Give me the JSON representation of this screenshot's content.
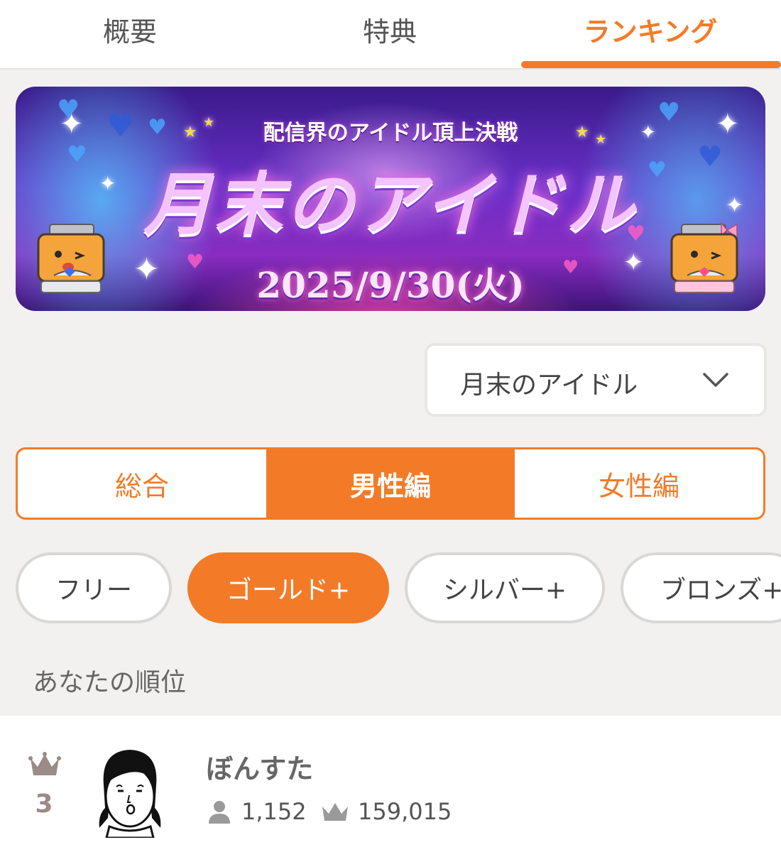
{
  "tabs": [
    {
      "label": "概要",
      "active": false
    },
    {
      "label": "特典",
      "active": false
    },
    {
      "label": "ランキング",
      "active": true
    }
  ],
  "banner": {
    "subtitle": "配信界のアイドル頂上決戦",
    "title": "月末のアイドル",
    "date": "2025/9/30(火)"
  },
  "dropdown": {
    "selected": "月末のアイドル",
    "icon": "chevron-down-icon"
  },
  "segments": [
    {
      "label": "総合",
      "active": false
    },
    {
      "label": "男性編",
      "active": true
    },
    {
      "label": "女性編",
      "active": false
    }
  ],
  "tiers": [
    {
      "label": "フリー",
      "active": false
    },
    {
      "label": "ゴールド+",
      "active": true
    },
    {
      "label": "シルバー+",
      "active": false
    },
    {
      "label": "ブロンズ+",
      "active": false
    }
  ],
  "your_rank": {
    "section_label": "あなたの順位",
    "rank": "3",
    "name": "ぼんすた",
    "followers": "1,152",
    "points": "159,015"
  },
  "colors": {
    "accent": "#f37b28",
    "background": "#f2f1ef",
    "rank_icon": "#9b8a85"
  }
}
